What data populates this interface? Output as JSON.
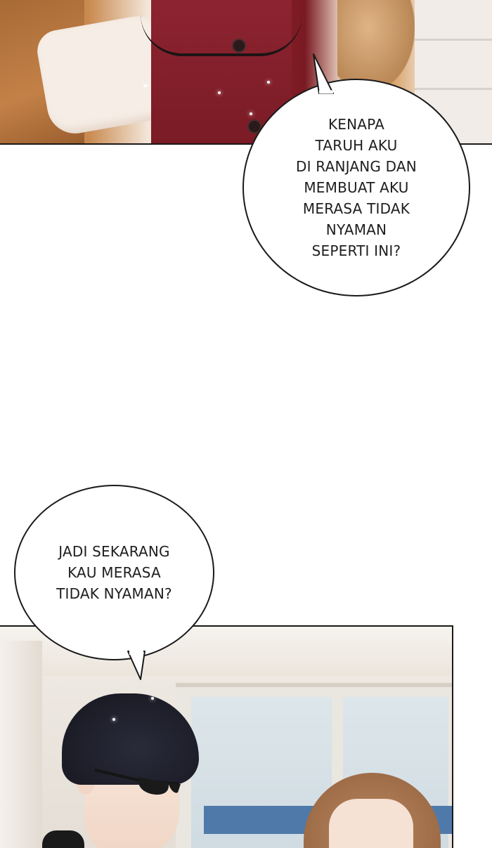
{
  "bubbles": {
    "first": "KENAPA\nTARUH AKU\nDI RANJANG DAN\nMEMBUAT AKU\nMERASA TIDAK\nNYAMAN\nSEPERTI INI?",
    "second": "JADI SEKARANG\nKAU MERASA\nTIDAK NYAMAN?"
  },
  "colors": {
    "shirt": "#8c2430",
    "jacket": "#c38147",
    "bubble_border": "#1a1a1a",
    "sign": "#4f79a8"
  }
}
